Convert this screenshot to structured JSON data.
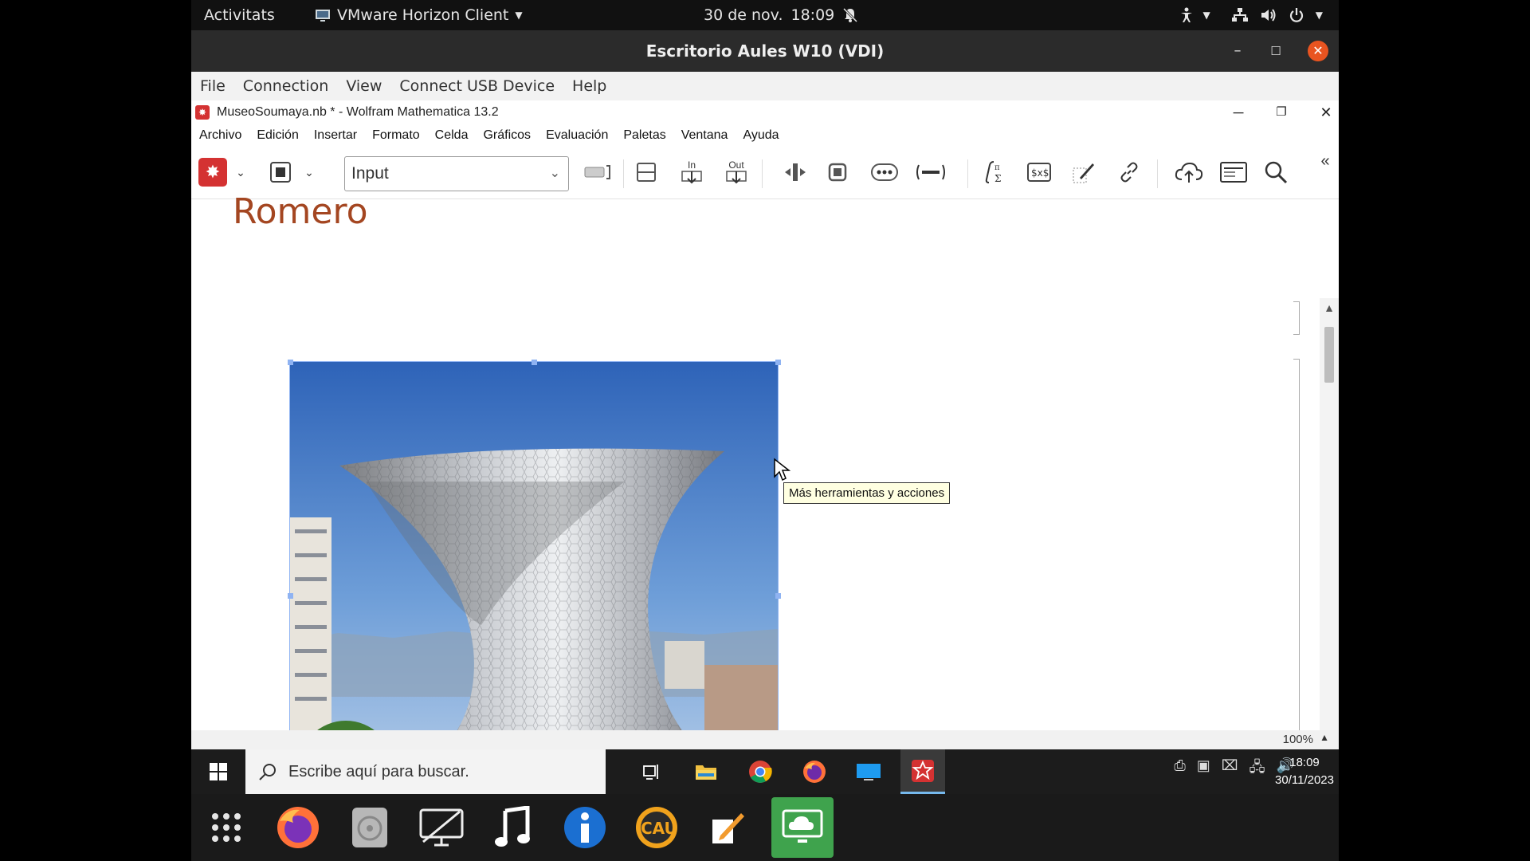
{
  "gnome": {
    "activities": "Activitats",
    "app_menu": "VMware Horizon Client",
    "date": "30 de nov.",
    "time": "18:09"
  },
  "horizon": {
    "title": "Escritorio Aules W10 (VDI)",
    "menu": [
      "File",
      "Connection",
      "View",
      "Connect USB Device",
      "Help"
    ]
  },
  "mathematica": {
    "title": "MuseoSoumaya.nb * - Wolfram Mathematica 13.2",
    "menu": [
      "Archivo",
      "Edición",
      "Insertar",
      "Formato",
      "Celda",
      "Gráficos",
      "Evaluación",
      "Paletas",
      "Ventana",
      "Ayuda"
    ],
    "style_select": "Input",
    "toolbar_in": "In",
    "toolbar_out": "Out",
    "notebook": {
      "section_title": "Romero"
    },
    "tooltip": "Más herramientas y acciones",
    "zoom": "100%"
  },
  "windows": {
    "search_placeholder": "Escribe aquí para buscar.",
    "time": "18:09",
    "date": "30/11/2023"
  },
  "colors": {
    "mathematica_red": "#d43232",
    "ubuntu_orange": "#e95420",
    "section_title": "#a44621"
  }
}
